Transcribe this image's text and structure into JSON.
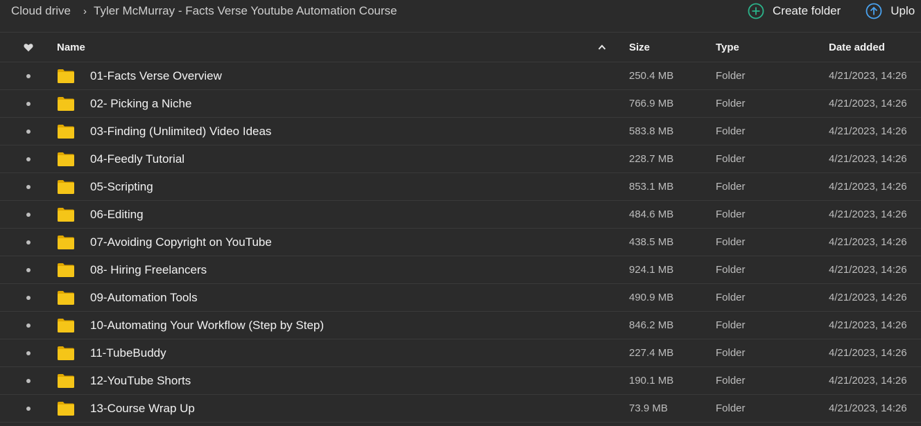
{
  "breadcrumb": {
    "root": "Cloud drive",
    "separator": "›",
    "current": "Tyler McMurray - Facts Verse Youtube Automation Course"
  },
  "actions": {
    "create_folder": {
      "label": "Create folder",
      "icon": "plus-circle-icon",
      "color": "#2bb38a"
    },
    "upload": {
      "label": "Uplo",
      "icon": "upload-circle-icon",
      "color": "#4aa3f0"
    }
  },
  "columns": {
    "favourite_icon": "heart-icon",
    "name": "Name",
    "sort_indicator": "^",
    "size": "Size",
    "type": "Type",
    "date_added": "Date added"
  },
  "rows": [
    {
      "name": "01-Facts Verse Overview",
      "size": "250.4 MB",
      "type": "Folder",
      "date": "4/21/2023, 14:26"
    },
    {
      "name": "02- Picking a Niche",
      "size": "766.9 MB",
      "type": "Folder",
      "date": "4/21/2023, 14:26"
    },
    {
      "name": "03-Finding (Unlimited) Video Ideas",
      "size": "583.8 MB",
      "type": "Folder",
      "date": "4/21/2023, 14:26"
    },
    {
      "name": "04-Feedly Tutorial",
      "size": "228.7 MB",
      "type": "Folder",
      "date": "4/21/2023, 14:26"
    },
    {
      "name": "05-Scripting",
      "size": "853.1 MB",
      "type": "Folder",
      "date": "4/21/2023, 14:26"
    },
    {
      "name": "06-Editing",
      "size": "484.6 MB",
      "type": "Folder",
      "date": "4/21/2023, 14:26"
    },
    {
      "name": "07-Avoiding Copyright on YouTube",
      "size": "438.5 MB",
      "type": "Folder",
      "date": "4/21/2023, 14:26"
    },
    {
      "name": "08- Hiring Freelancers",
      "size": "924.1 MB",
      "type": "Folder",
      "date": "4/21/2023, 14:26"
    },
    {
      "name": "09-Automation Tools",
      "size": "490.9 MB",
      "type": "Folder",
      "date": "4/21/2023, 14:26"
    },
    {
      "name": "10-Automating Your Workflow (Step by Step)",
      "size": "846.2 MB",
      "type": "Folder",
      "date": "4/21/2023, 14:26"
    },
    {
      "name": "11-TubeBuddy",
      "size": "227.4 MB",
      "type": "Folder",
      "date": "4/21/2023, 14:26"
    },
    {
      "name": "12-YouTube Shorts",
      "size": "190.1 MB",
      "type": "Folder",
      "date": "4/21/2023, 14:26"
    },
    {
      "name": "13-Course Wrap Up",
      "size": "73.9 MB",
      "type": "Folder",
      "date": "4/21/2023, 14:26"
    }
  ],
  "row_icon": "folder-icon",
  "folder_color": "#f5c518"
}
